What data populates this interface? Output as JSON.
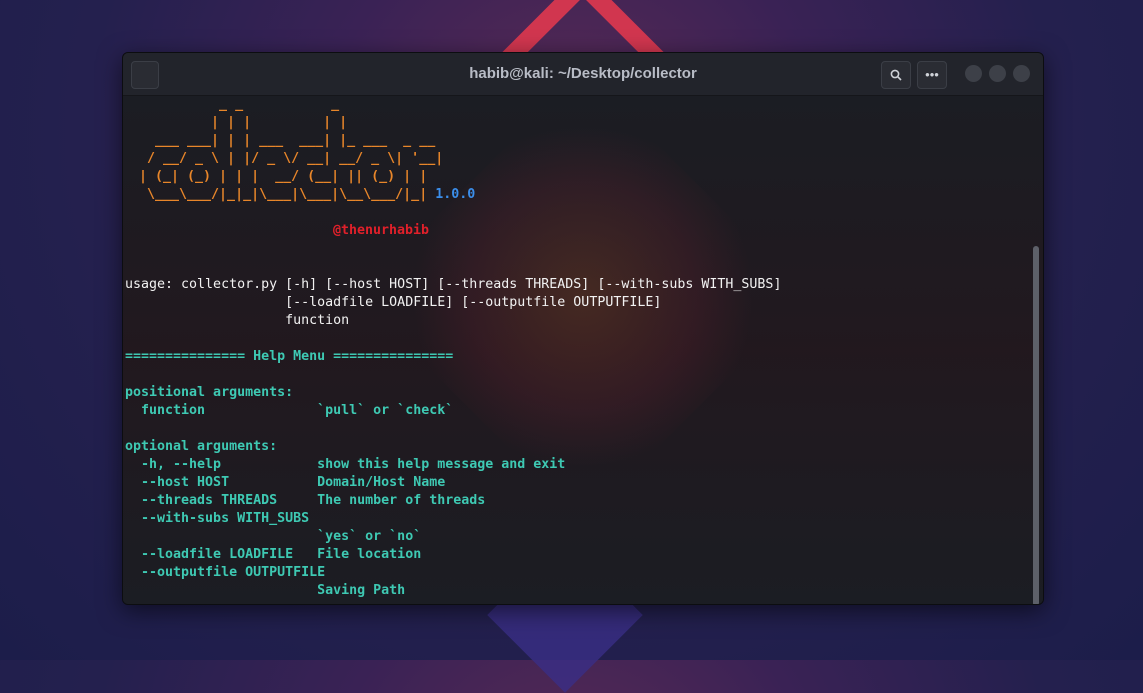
{
  "window": {
    "title": "habib@kali: ~/Desktop/collector",
    "search_icon": "search-icon",
    "menu_icon": "more-icon",
    "menu_label": "•••",
    "search_label": "⌕"
  },
  "terminal": {
    "banner": "          _ _           _\n         | | |         | |\n  ___ ___| | | ___  ___| |_ ___  _ __\n / __/ _ \\ | |/ _ \\/ __| __/ _ \\| '__|\n| (_| (_) | | |  __/ (__| || (_) | |\n \\___\\___/|_|_|\\___|\\___|\\__\\___/|_|",
    "version": "1.0.0",
    "author": "@thenurhabib",
    "usage": "usage: collector.py [-h] [--host HOST] [--threads THREADS] [--with-subs WITH_SUBS]\n                    [--loadfile LOADFILE] [--outputfile OUTPUTFILE]\n                    function",
    "help": "=============== Help Menu ===============\n\npositional arguments:\n  function              `pull` or `check`\n\noptional arguments:\n  -h, --help            show this help message and exit\n  --host HOST           Domain/Host Name\n  --threads THREADS     The number of threads\n  --with-subs WITH_SUBS\n                        `yes` or `no`\n  --loadfile LOADFILE   File location\n  --outputfile OUTPUTFILE\n                        Saving Path"
  },
  "colors": {
    "ascii": "#e8862a",
    "version": "#3b8eea",
    "author": "#e0202a",
    "help": "#3ec9b3"
  }
}
